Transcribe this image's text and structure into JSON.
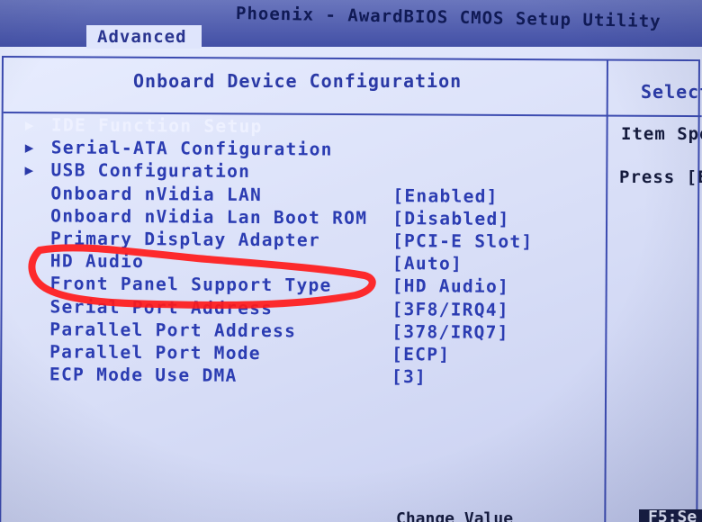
{
  "window": {
    "title": "Phoenix - AwardBIOS CMOS Setup Utility",
    "active_tab": "Advanced"
  },
  "section": {
    "title": "Onboard Device Configuration"
  },
  "help_panel": {
    "header": "Select",
    "line1": "Item Spe",
    "line2": "Press [E"
  },
  "menu": {
    "items": [
      {
        "label": "IDE Function Setup",
        "value": "",
        "submenu": true,
        "icon": "triangle-right-icon"
      },
      {
        "label": "Serial-ATA Configuration",
        "value": "",
        "submenu": true,
        "icon": "triangle-right-icon"
      },
      {
        "label": "USB Configuration",
        "value": "",
        "submenu": true,
        "icon": "triangle-right-icon"
      },
      {
        "label": "Onboard nVidia LAN",
        "value": "[Enabled]"
      },
      {
        "label": "Onboard nVidia Lan Boot ROM",
        "value": "[Disabled]"
      },
      {
        "label": "Primary Display Adapter",
        "value": "[PCI-E Slot]"
      },
      {
        "label": "HD Audio",
        "value": "[Auto]"
      },
      {
        "label": "Front Panel Support Type",
        "value": "[HD Audio]"
      },
      {
        "label": "Serial Port Address",
        "value": "[3F8/IRQ4]"
      },
      {
        "label": "Parallel Port Address",
        "value": "[378/IRQ7]"
      },
      {
        "label": "Parallel Port Mode",
        "value": "[ECP]"
      },
      {
        "label": "ECP Mode Use DMA",
        "value": "[3]"
      }
    ]
  },
  "footer": {
    "left": "Change Value",
    "right": "F5:Se"
  },
  "colors": {
    "screen_bg": "#dfe5fc",
    "title_bar": "#4350a6",
    "menu_text": "#2b3cb2",
    "selected_text": "#eef1ff",
    "annotation": "#ff1a1a"
  }
}
